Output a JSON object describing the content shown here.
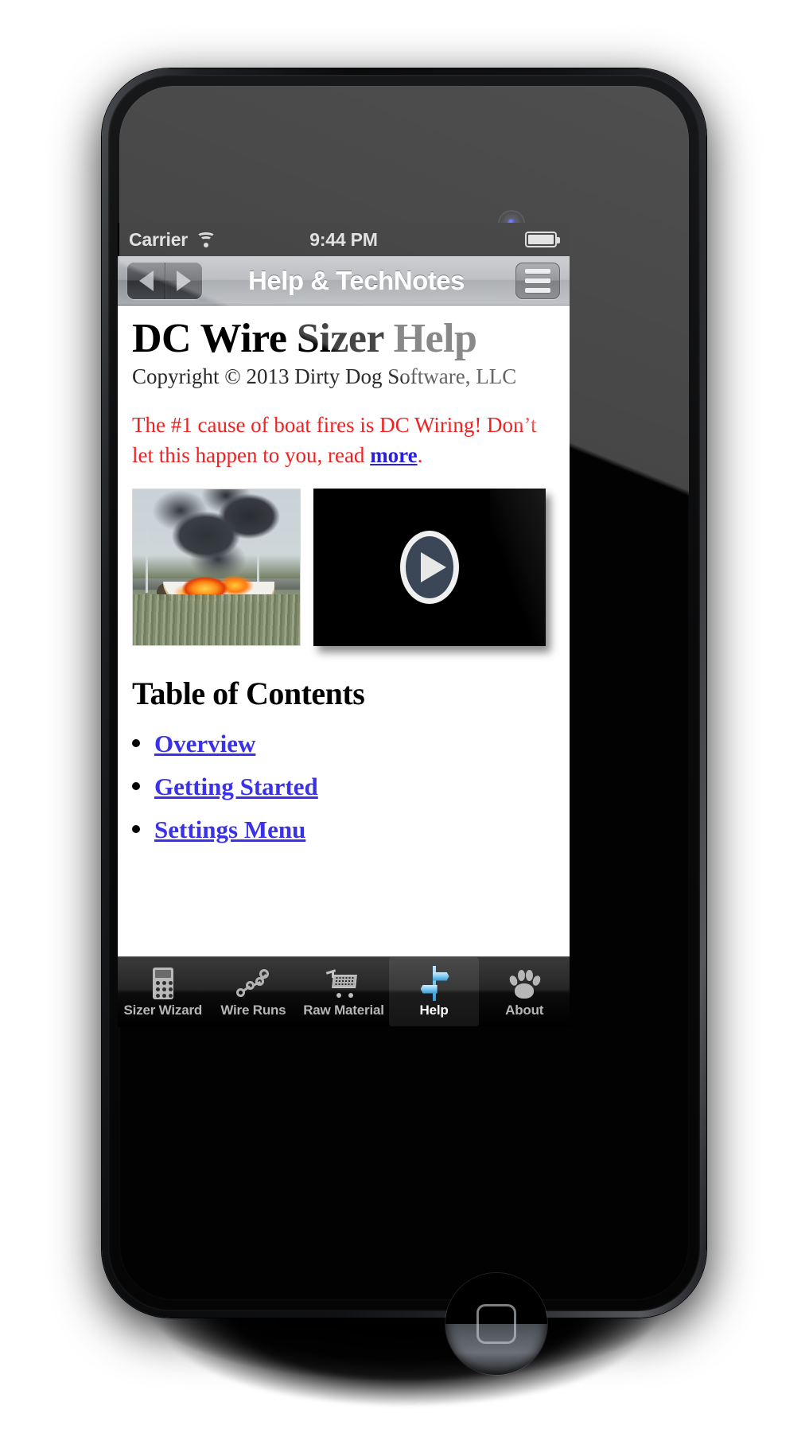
{
  "device": {
    "name": "iphone-5-black",
    "home_button": "home-button"
  },
  "status_bar": {
    "carrier": "Carrier",
    "wifi_icon": "wifi-icon",
    "time": "9:44 PM",
    "battery_icon": "battery-icon"
  },
  "nav_bar": {
    "back_icon": "back-arrow-icon",
    "forward_icon": "forward-arrow-icon",
    "title": "Help & TechNotes",
    "menu_icon": "hamburger-menu-icon"
  },
  "content": {
    "title_main": "DC Wire Sizer",
    "title_suffix": "Help",
    "copyright": "Copyright © 2013 Dirty Dog Software, LLC",
    "warning_prefix": "The #1 cause of boat fires is DC Wiring! Don’t let this happen to you, read ",
    "warning_link": "more",
    "warning_suffix": ".",
    "boat_image_name": "burning-boat-photo",
    "video_thumb_name": "video-player-thumbnail",
    "play_icon": "play-button-icon",
    "toc_heading": "Table of Contents",
    "toc_links": [
      {
        "label": "Overview"
      },
      {
        "label": "Getting Started"
      },
      {
        "label": "Settings Menu"
      }
    ]
  },
  "tab_bar": {
    "selected_index": 3,
    "tabs": [
      {
        "label": "Sizer Wizard",
        "icon": "calculator-icon"
      },
      {
        "label": "Wire Runs",
        "icon": "wire-chain-icon"
      },
      {
        "label": "Raw Material",
        "icon": "shopping-cart-icon"
      },
      {
        "label": "Help",
        "icon": "signpost-icon"
      },
      {
        "label": "About",
        "icon": "paw-print-icon"
      }
    ]
  },
  "colors": {
    "link": "#3a31e8",
    "warning": "#ee2222",
    "tab_selected_accent": "#2f9ddb",
    "background": "#ffffff"
  }
}
